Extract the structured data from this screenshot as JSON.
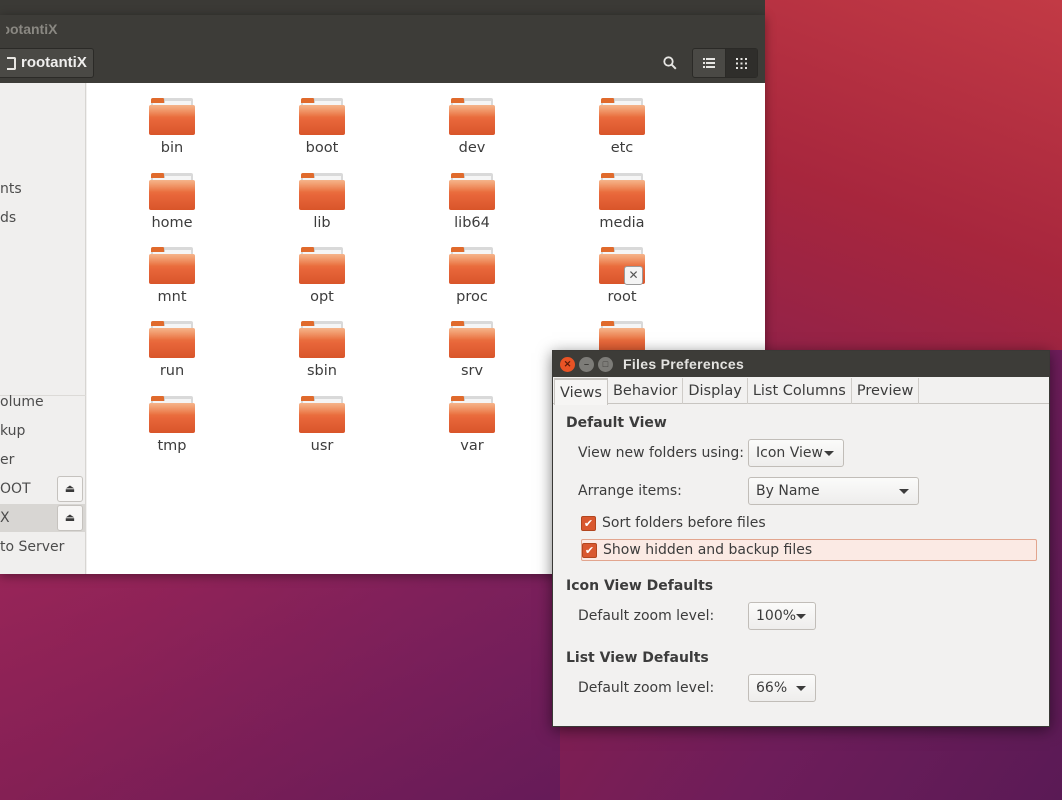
{
  "desktop": {
    "panel_color": "#3b3a36"
  },
  "files_window": {
    "title": "rootantiX",
    "path_button": "rootantiX",
    "toolbar": {
      "search_icon": "search-icon",
      "list_view_icon": "list-view-icon",
      "grid_view_icon": "grid-view-icon"
    },
    "sidebar": {
      "items": [
        {
          "label": "nts"
        },
        {
          "label": "ds"
        },
        {
          "label": "olume"
        },
        {
          "label": "kup"
        },
        {
          "label": "er"
        },
        {
          "label": "OOT"
        },
        {
          "label": "X"
        },
        {
          "label": "to Server"
        }
      ]
    },
    "folders": [
      {
        "name": "bin"
      },
      {
        "name": "boot"
      },
      {
        "name": "dev"
      },
      {
        "name": "etc"
      },
      {
        "name": "home"
      },
      {
        "name": "lib"
      },
      {
        "name": "lib64"
      },
      {
        "name": "media"
      },
      {
        "name": "mnt"
      },
      {
        "name": "opt"
      },
      {
        "name": "proc"
      },
      {
        "name": "root"
      },
      {
        "name": "run"
      },
      {
        "name": "sbin"
      },
      {
        "name": "srv"
      },
      {
        "name": ""
      },
      {
        "name": "tmp"
      },
      {
        "name": "usr"
      },
      {
        "name": "var"
      }
    ],
    "folder_color": "#e8663a"
  },
  "preferences": {
    "title": "Files Preferences",
    "tabs": [
      "Views",
      "Behavior",
      "Display",
      "List Columns",
      "Preview"
    ],
    "default_view": {
      "heading": "Default View",
      "view_label": "View new folders using:",
      "view_value": "Icon View",
      "arrange_label": "Arrange items:",
      "arrange_value": "By Name",
      "sort_folders_label": "Sort folders before files",
      "sort_folders_checked": true,
      "show_hidden_label": "Show hidden and backup files",
      "show_hidden_checked": true
    },
    "icon_view": {
      "heading": "Icon View Defaults",
      "zoom_label": "Default zoom level:",
      "zoom_value": "100%"
    },
    "list_view": {
      "heading": "List View Defaults",
      "zoom_label": "Default zoom level:",
      "zoom_value": "66%"
    },
    "accent_color": "#d9582f"
  }
}
